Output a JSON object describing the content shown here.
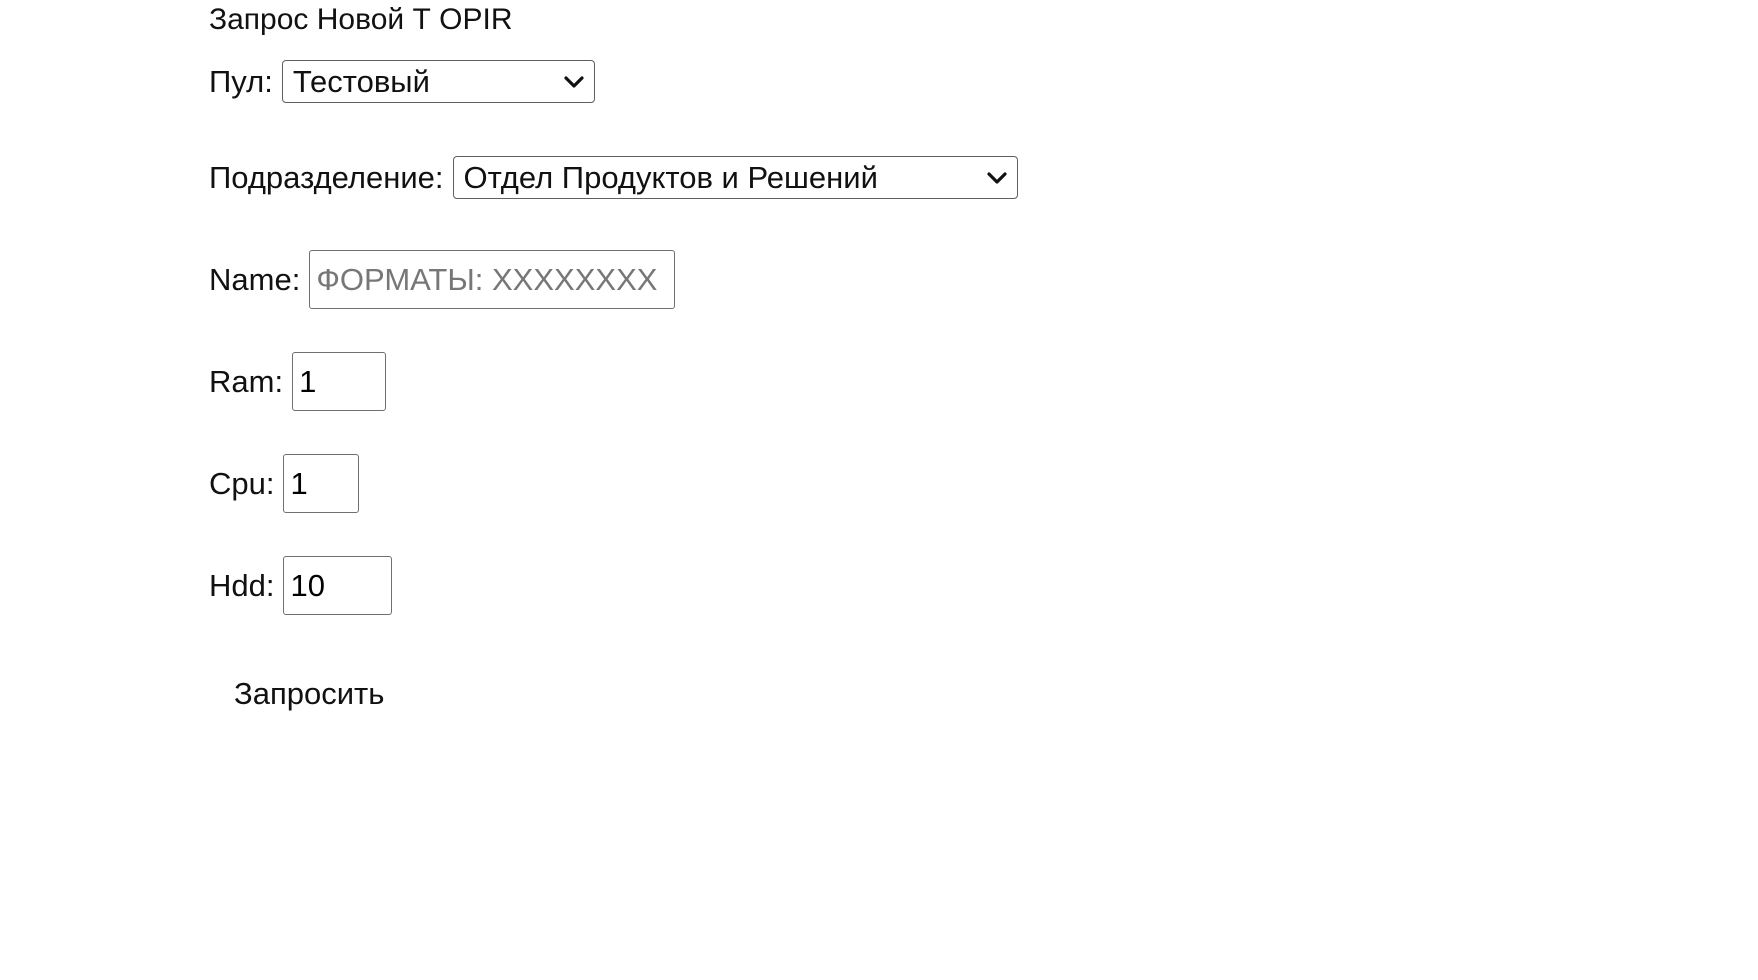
{
  "form": {
    "title": "Запрос Новой Т OPIR",
    "pool": {
      "label": "Пул:",
      "selected": "Тестовый"
    },
    "division": {
      "label": "Подразделение:",
      "selected": "Отдел Продуктов и Решений"
    },
    "name": {
      "label": "Name:",
      "value": "",
      "placeholder": "ФОРМАТЫ: XXXXXXXX"
    },
    "ram": {
      "label": "Ram:",
      "value": "1"
    },
    "cpu": {
      "label": "Cpu:",
      "value": "1"
    },
    "hdd": {
      "label": "Hdd:",
      "value": "10"
    },
    "submit_label": "Запросить"
  },
  "icons": {
    "select_arrow": "chevron-down-icon"
  }
}
